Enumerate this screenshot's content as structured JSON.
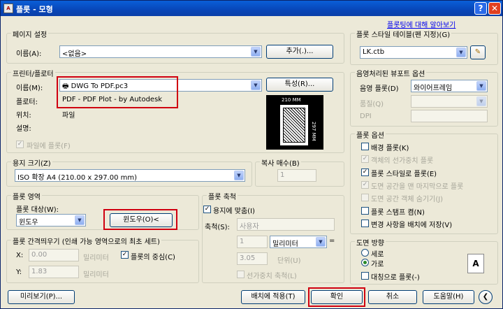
{
  "title": "플롯 - 모형",
  "help_link": "플롯팅에 대해 알아보기",
  "page_setup": {
    "group": "페이지 설정",
    "name_label": "이름(A):",
    "name_value": "<없음>",
    "add_button": "추가(.)..."
  },
  "printer": {
    "group": "프린터/플로터",
    "name_label": "이름(M):",
    "name_value": "DWG To PDF.pc3",
    "properties_button": "특성(R)...",
    "plotter_label": "플로터:",
    "plotter_value": "PDF - PDF Plot - by Autodesk",
    "location_label": "위치:",
    "location_value": "파일",
    "desc_label": "설명:",
    "plot_to_file": "파일에 플롯(F)",
    "preview_width": "210 MM",
    "preview_height": "297 MM"
  },
  "paper_size": {
    "group": "용지 크기(Z)",
    "value": "ISO 확장 A4 (210.00 x 297.00 mm)"
  },
  "copies": {
    "group": "복사 매수(B)",
    "value": "1"
  },
  "plot_area": {
    "group": "플롯 영역",
    "target_label": "플롯 대상(W):",
    "target_value": "윈도우",
    "window_button": "윈도우(O)<"
  },
  "plot_offset": {
    "group": "플롯 간격띄우기 (인쇄 가능 영역으로의 최초 세트)",
    "x_label": "X:",
    "x_value": "0.00",
    "y_label": "Y:",
    "y_value": "1.83",
    "unit": "밀리미터",
    "center": "플롯의 중심(C)"
  },
  "plot_scale": {
    "group": "플롯 축척",
    "fit": "용지에 맞춤(I)",
    "scale_label": "축척(S):",
    "scale_value": "사용자",
    "v1": "1",
    "unit_value": "밀리미터",
    "v2": "3.05",
    "unit2": "단위(U)",
    "lineweight": "선가중치 축척(L)"
  },
  "plot_style": {
    "group": "플롯 스타일 테이블(펜 지정)(G)",
    "value": "LK.ctb"
  },
  "shaded": {
    "group": "음영처리된 뷰포트 옵션",
    "shade_label": "음영 플롯(D)",
    "shade_value": "와이어프레임",
    "quality_label": "품질(Q)",
    "dpi_label": "DPI"
  },
  "options": {
    "group": "플롯 옵션",
    "items": [
      {
        "label": "배경 플롯(K)",
        "state": "off",
        "enabled": true
      },
      {
        "label": "객체의 선가중치 플롯",
        "state": "on",
        "enabled": false
      },
      {
        "label": "플롯 스타일로 플롯(E)",
        "state": "on",
        "enabled": true
      },
      {
        "label": "도면 공간을 맨 마지막으로 플롯",
        "state": "on",
        "enabled": false
      },
      {
        "label": "도면 공간 객체 숨기기(J)",
        "state": "off",
        "enabled": false
      },
      {
        "label": "플롯 스탬프 켬(N)",
        "state": "off",
        "enabled": true
      },
      {
        "label": "변경 사항을 배치에 저장(V)",
        "state": "off",
        "enabled": true
      }
    ]
  },
  "orientation": {
    "group": "도면 방향",
    "portrait": "세로",
    "landscape": "가로",
    "upside": "대칭으로 플롯(-)",
    "letter": "A"
  },
  "buttons": {
    "preview": "미리보기(P)...",
    "apply": "배치에 적용(T)",
    "ok": "확인",
    "cancel": "취소",
    "help": "도움말(H)"
  }
}
